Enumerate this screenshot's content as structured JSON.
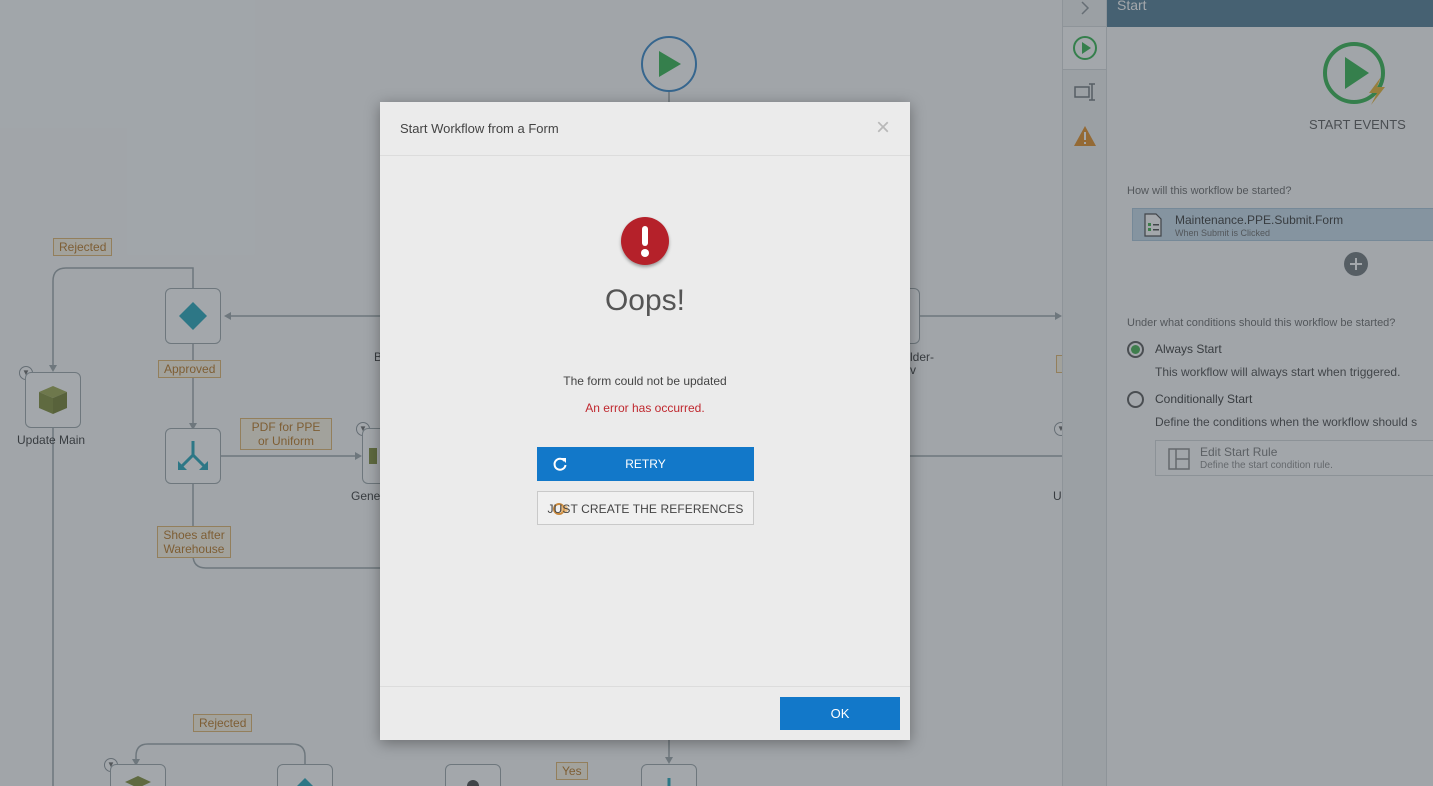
{
  "canvas": {
    "labels": {
      "rejected_top": "Rejected",
      "approved": "Approved",
      "pdf_for_ppe": "PDF for PPE or Uniform",
      "shoes_after_warehouse": "Shoes after Warehouse",
      "rejected_bottom": "Rejected",
      "yes": "Yes"
    },
    "captions": {
      "update_main": "Update Main",
      "gene_partial": "Gene",
      "b_partial": "B",
      "folder_partial": "lder-",
      "folder_partial2": "v",
      "u_partial": "U"
    }
  },
  "panel": {
    "header": "Start",
    "start_events_label": "START EVENTS",
    "question_how": "How will this workflow be started?",
    "start_item": {
      "name": "Maintenance.PPE.Submit.Form",
      "subtitle": "When Submit is Clicked"
    },
    "question_conditions": "Under what conditions should this workflow be started?",
    "always": {
      "label": "Always Start",
      "desc": "This workflow will always start when triggered."
    },
    "conditional": {
      "label": "Conditionally Start",
      "desc": "Define the conditions when the workflow should s"
    },
    "rule": {
      "title": "Edit Start Rule",
      "subtitle": "Define the start condition rule."
    }
  },
  "modal": {
    "title": "Start Workflow from a Form",
    "close_glyph": "×",
    "heading": "Oops!",
    "message": "The form could not be updated",
    "error": "An error has occurred.",
    "retry_label": "RETRY",
    "refs_label": "JUST CREATE THE REFERENCES",
    "ok_label": "OK"
  },
  "colors": {
    "primary_button": "#1278c9",
    "error_red": "#b5212a",
    "tag_border": "#e0b368",
    "panel_header": "#4d7a92",
    "radio_on": "#3fae49"
  },
  "icons": [
    "play-icon",
    "start-events-icon",
    "form-icon",
    "add-icon",
    "warning-icon",
    "rule-icon",
    "refresh-icon",
    "error-icon"
  ]
}
